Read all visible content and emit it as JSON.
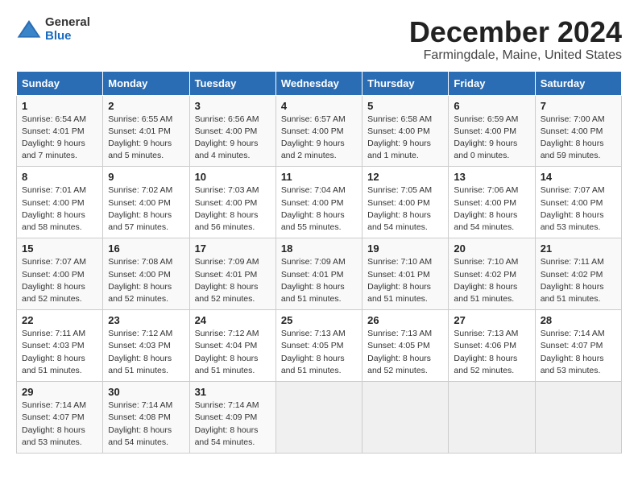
{
  "logo": {
    "general": "General",
    "blue": "Blue"
  },
  "title": "December 2024",
  "subtitle": "Farmingdale, Maine, United States",
  "weekdays": [
    "Sunday",
    "Monday",
    "Tuesday",
    "Wednesday",
    "Thursday",
    "Friday",
    "Saturday"
  ],
  "weeks": [
    [
      {
        "day": 1,
        "sunrise": "6:54 AM",
        "sunset": "4:01 PM",
        "daylight": "9 hours and 7 minutes."
      },
      {
        "day": 2,
        "sunrise": "6:55 AM",
        "sunset": "4:01 PM",
        "daylight": "9 hours and 5 minutes."
      },
      {
        "day": 3,
        "sunrise": "6:56 AM",
        "sunset": "4:00 PM",
        "daylight": "9 hours and 4 minutes."
      },
      {
        "day": 4,
        "sunrise": "6:57 AM",
        "sunset": "4:00 PM",
        "daylight": "9 hours and 2 minutes."
      },
      {
        "day": 5,
        "sunrise": "6:58 AM",
        "sunset": "4:00 PM",
        "daylight": "9 hours and 1 minute."
      },
      {
        "day": 6,
        "sunrise": "6:59 AM",
        "sunset": "4:00 PM",
        "daylight": "9 hours and 0 minutes."
      },
      {
        "day": 7,
        "sunrise": "7:00 AM",
        "sunset": "4:00 PM",
        "daylight": "8 hours and 59 minutes."
      }
    ],
    [
      {
        "day": 8,
        "sunrise": "7:01 AM",
        "sunset": "4:00 PM",
        "daylight": "8 hours and 58 minutes."
      },
      {
        "day": 9,
        "sunrise": "7:02 AM",
        "sunset": "4:00 PM",
        "daylight": "8 hours and 57 minutes."
      },
      {
        "day": 10,
        "sunrise": "7:03 AM",
        "sunset": "4:00 PM",
        "daylight": "8 hours and 56 minutes."
      },
      {
        "day": 11,
        "sunrise": "7:04 AM",
        "sunset": "4:00 PM",
        "daylight": "8 hours and 55 minutes."
      },
      {
        "day": 12,
        "sunrise": "7:05 AM",
        "sunset": "4:00 PM",
        "daylight": "8 hours and 54 minutes."
      },
      {
        "day": 13,
        "sunrise": "7:06 AM",
        "sunset": "4:00 PM",
        "daylight": "8 hours and 54 minutes."
      },
      {
        "day": 14,
        "sunrise": "7:07 AM",
        "sunset": "4:00 PM",
        "daylight": "8 hours and 53 minutes."
      }
    ],
    [
      {
        "day": 15,
        "sunrise": "7:07 AM",
        "sunset": "4:00 PM",
        "daylight": "8 hours and 52 minutes."
      },
      {
        "day": 16,
        "sunrise": "7:08 AM",
        "sunset": "4:00 PM",
        "daylight": "8 hours and 52 minutes."
      },
      {
        "day": 17,
        "sunrise": "7:09 AM",
        "sunset": "4:01 PM",
        "daylight": "8 hours and 52 minutes."
      },
      {
        "day": 18,
        "sunrise": "7:09 AM",
        "sunset": "4:01 PM",
        "daylight": "8 hours and 51 minutes."
      },
      {
        "day": 19,
        "sunrise": "7:10 AM",
        "sunset": "4:01 PM",
        "daylight": "8 hours and 51 minutes."
      },
      {
        "day": 20,
        "sunrise": "7:10 AM",
        "sunset": "4:02 PM",
        "daylight": "8 hours and 51 minutes."
      },
      {
        "day": 21,
        "sunrise": "7:11 AM",
        "sunset": "4:02 PM",
        "daylight": "8 hours and 51 minutes."
      }
    ],
    [
      {
        "day": 22,
        "sunrise": "7:11 AM",
        "sunset": "4:03 PM",
        "daylight": "8 hours and 51 minutes."
      },
      {
        "day": 23,
        "sunrise": "7:12 AM",
        "sunset": "4:03 PM",
        "daylight": "8 hours and 51 minutes."
      },
      {
        "day": 24,
        "sunrise": "7:12 AM",
        "sunset": "4:04 PM",
        "daylight": "8 hours and 51 minutes."
      },
      {
        "day": 25,
        "sunrise": "7:13 AM",
        "sunset": "4:05 PM",
        "daylight": "8 hours and 51 minutes."
      },
      {
        "day": 26,
        "sunrise": "7:13 AM",
        "sunset": "4:05 PM",
        "daylight": "8 hours and 52 minutes."
      },
      {
        "day": 27,
        "sunrise": "7:13 AM",
        "sunset": "4:06 PM",
        "daylight": "8 hours and 52 minutes."
      },
      {
        "day": 28,
        "sunrise": "7:14 AM",
        "sunset": "4:07 PM",
        "daylight": "8 hours and 53 minutes."
      }
    ],
    [
      {
        "day": 29,
        "sunrise": "7:14 AM",
        "sunset": "4:07 PM",
        "daylight": "8 hours and 53 minutes."
      },
      {
        "day": 30,
        "sunrise": "7:14 AM",
        "sunset": "4:08 PM",
        "daylight": "8 hours and 54 minutes."
      },
      {
        "day": 31,
        "sunrise": "7:14 AM",
        "sunset": "4:09 PM",
        "daylight": "8 hours and 54 minutes."
      },
      null,
      null,
      null,
      null
    ]
  ]
}
